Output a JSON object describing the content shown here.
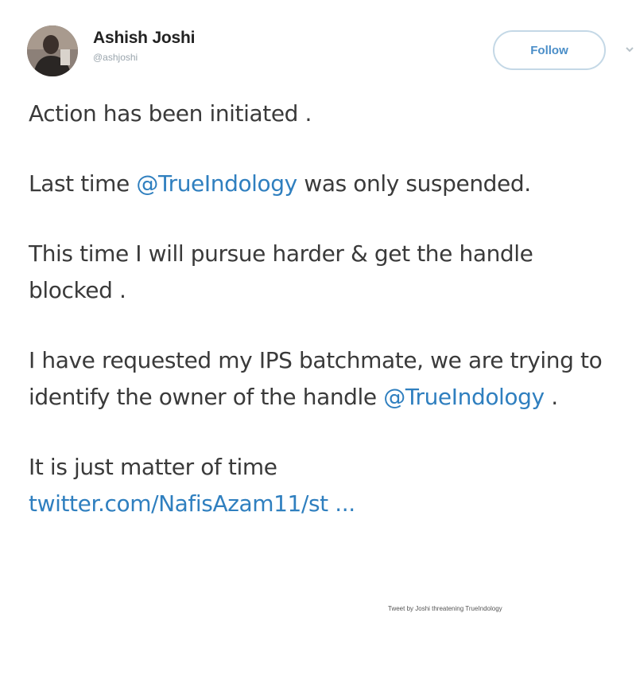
{
  "tweet": {
    "author": {
      "name": "Ashish Joshi",
      "handle": "@ashjoshi"
    },
    "follow_label": "Follow",
    "paragraphs": {
      "p1": "Action has been initiated .",
      "p2_pre": "Last time ",
      "p2_mention": "@TrueIndology",
      "p2_post": " was only suspended.",
      "p3": "This time I will pursue harder & get the handle blocked .",
      "p4_pre": "I have requested my IPS batchmate, we are trying to identify the owner of the handle ",
      "p4_mention": "@TrueIndology",
      "p4_post": " .",
      "p5_pre": "It is just matter of time ",
      "p5_link": "twitter.com/NafisAzam11/st ..."
    },
    "credit": "Tweet by Joshi threatening TrueIndology"
  },
  "colors": {
    "mention": "#2f7fbf",
    "follow_border": "#c4d8e6",
    "text": "#3a3a3a"
  },
  "icons": {
    "avatar": "user-avatar",
    "caret": "chevron-down-icon"
  }
}
